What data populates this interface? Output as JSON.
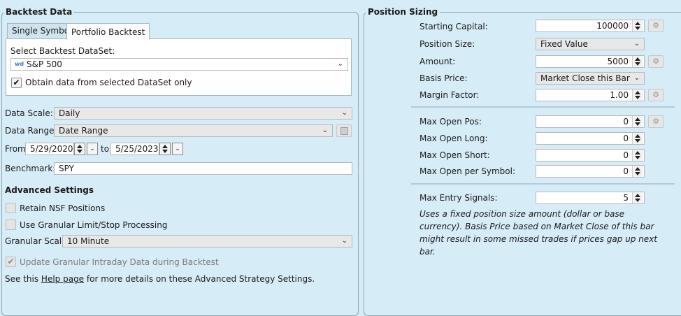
{
  "backtest": {
    "title": "Backtest Data",
    "tabs": [
      "Single Symbol",
      "Portfolio Backtest"
    ],
    "dataset_label": "Select Backtest DataSet:",
    "dataset_icon_text": "wd",
    "dataset_value": "S&P 500",
    "obtain_label": "Obtain data from selected DataSet only",
    "scale_label": "Data Scale:",
    "scale_value": "Daily",
    "range_label": "Data Range:",
    "range_value": "Date Range",
    "from_label": "From",
    "from_value": "5/29/2020",
    "to_label": "to",
    "to_value": "5/25/2023",
    "benchmark_label": "Benchmark:",
    "benchmark_value": "SPY",
    "advanced_title": "Advanced Settings",
    "retain_label": "Retain NSF Positions",
    "granular_label": "Use Granular Limit/Stop Processing",
    "granular_scale_label": "Granular Scale",
    "granular_scale_value": "10 Minute",
    "update_label": "Update Granular Intraday Data during Backtest",
    "help_prefix": "See this ",
    "help_link": "Help page",
    "help_suffix": " for more details on these Advanced Strategy Settings."
  },
  "sizing": {
    "title": "Position Sizing",
    "starting_capital_label": "Starting Capital:",
    "starting_capital_value": "100000",
    "position_size_label": "Position Size:",
    "position_size_value": "Fixed Value",
    "amount_label": "Amount:",
    "amount_value": "5000",
    "basis_label": "Basis Price:",
    "basis_value": "Market Close this Bar",
    "margin_label": "Margin Factor:",
    "margin_value": "1.00",
    "max_open_pos_label": "Max Open Pos:",
    "max_open_pos_value": "0",
    "max_open_long_label": "Max Open Long:",
    "max_open_long_value": "0",
    "max_open_short_label": "Max Open Short:",
    "max_open_short_value": "0",
    "max_open_symbol_label": "Max Open per Symbol:",
    "max_open_symbol_value": "0",
    "max_entry_label": "Max Entry Signals:",
    "max_entry_value": "5",
    "description": "Uses a fixed position size amount (dollar or base currency). Basis Price based on Market Close of this bar might result in some missed trades if prices gap up next bar."
  },
  "icons": {
    "check": "✔",
    "chevron": "⌄",
    "gear": "⚙",
    "save": "💾"
  },
  "colors": {
    "background": "#d6ecf7",
    "border": "#8fa6b3",
    "dataset_icon": "#3a7bd5"
  }
}
